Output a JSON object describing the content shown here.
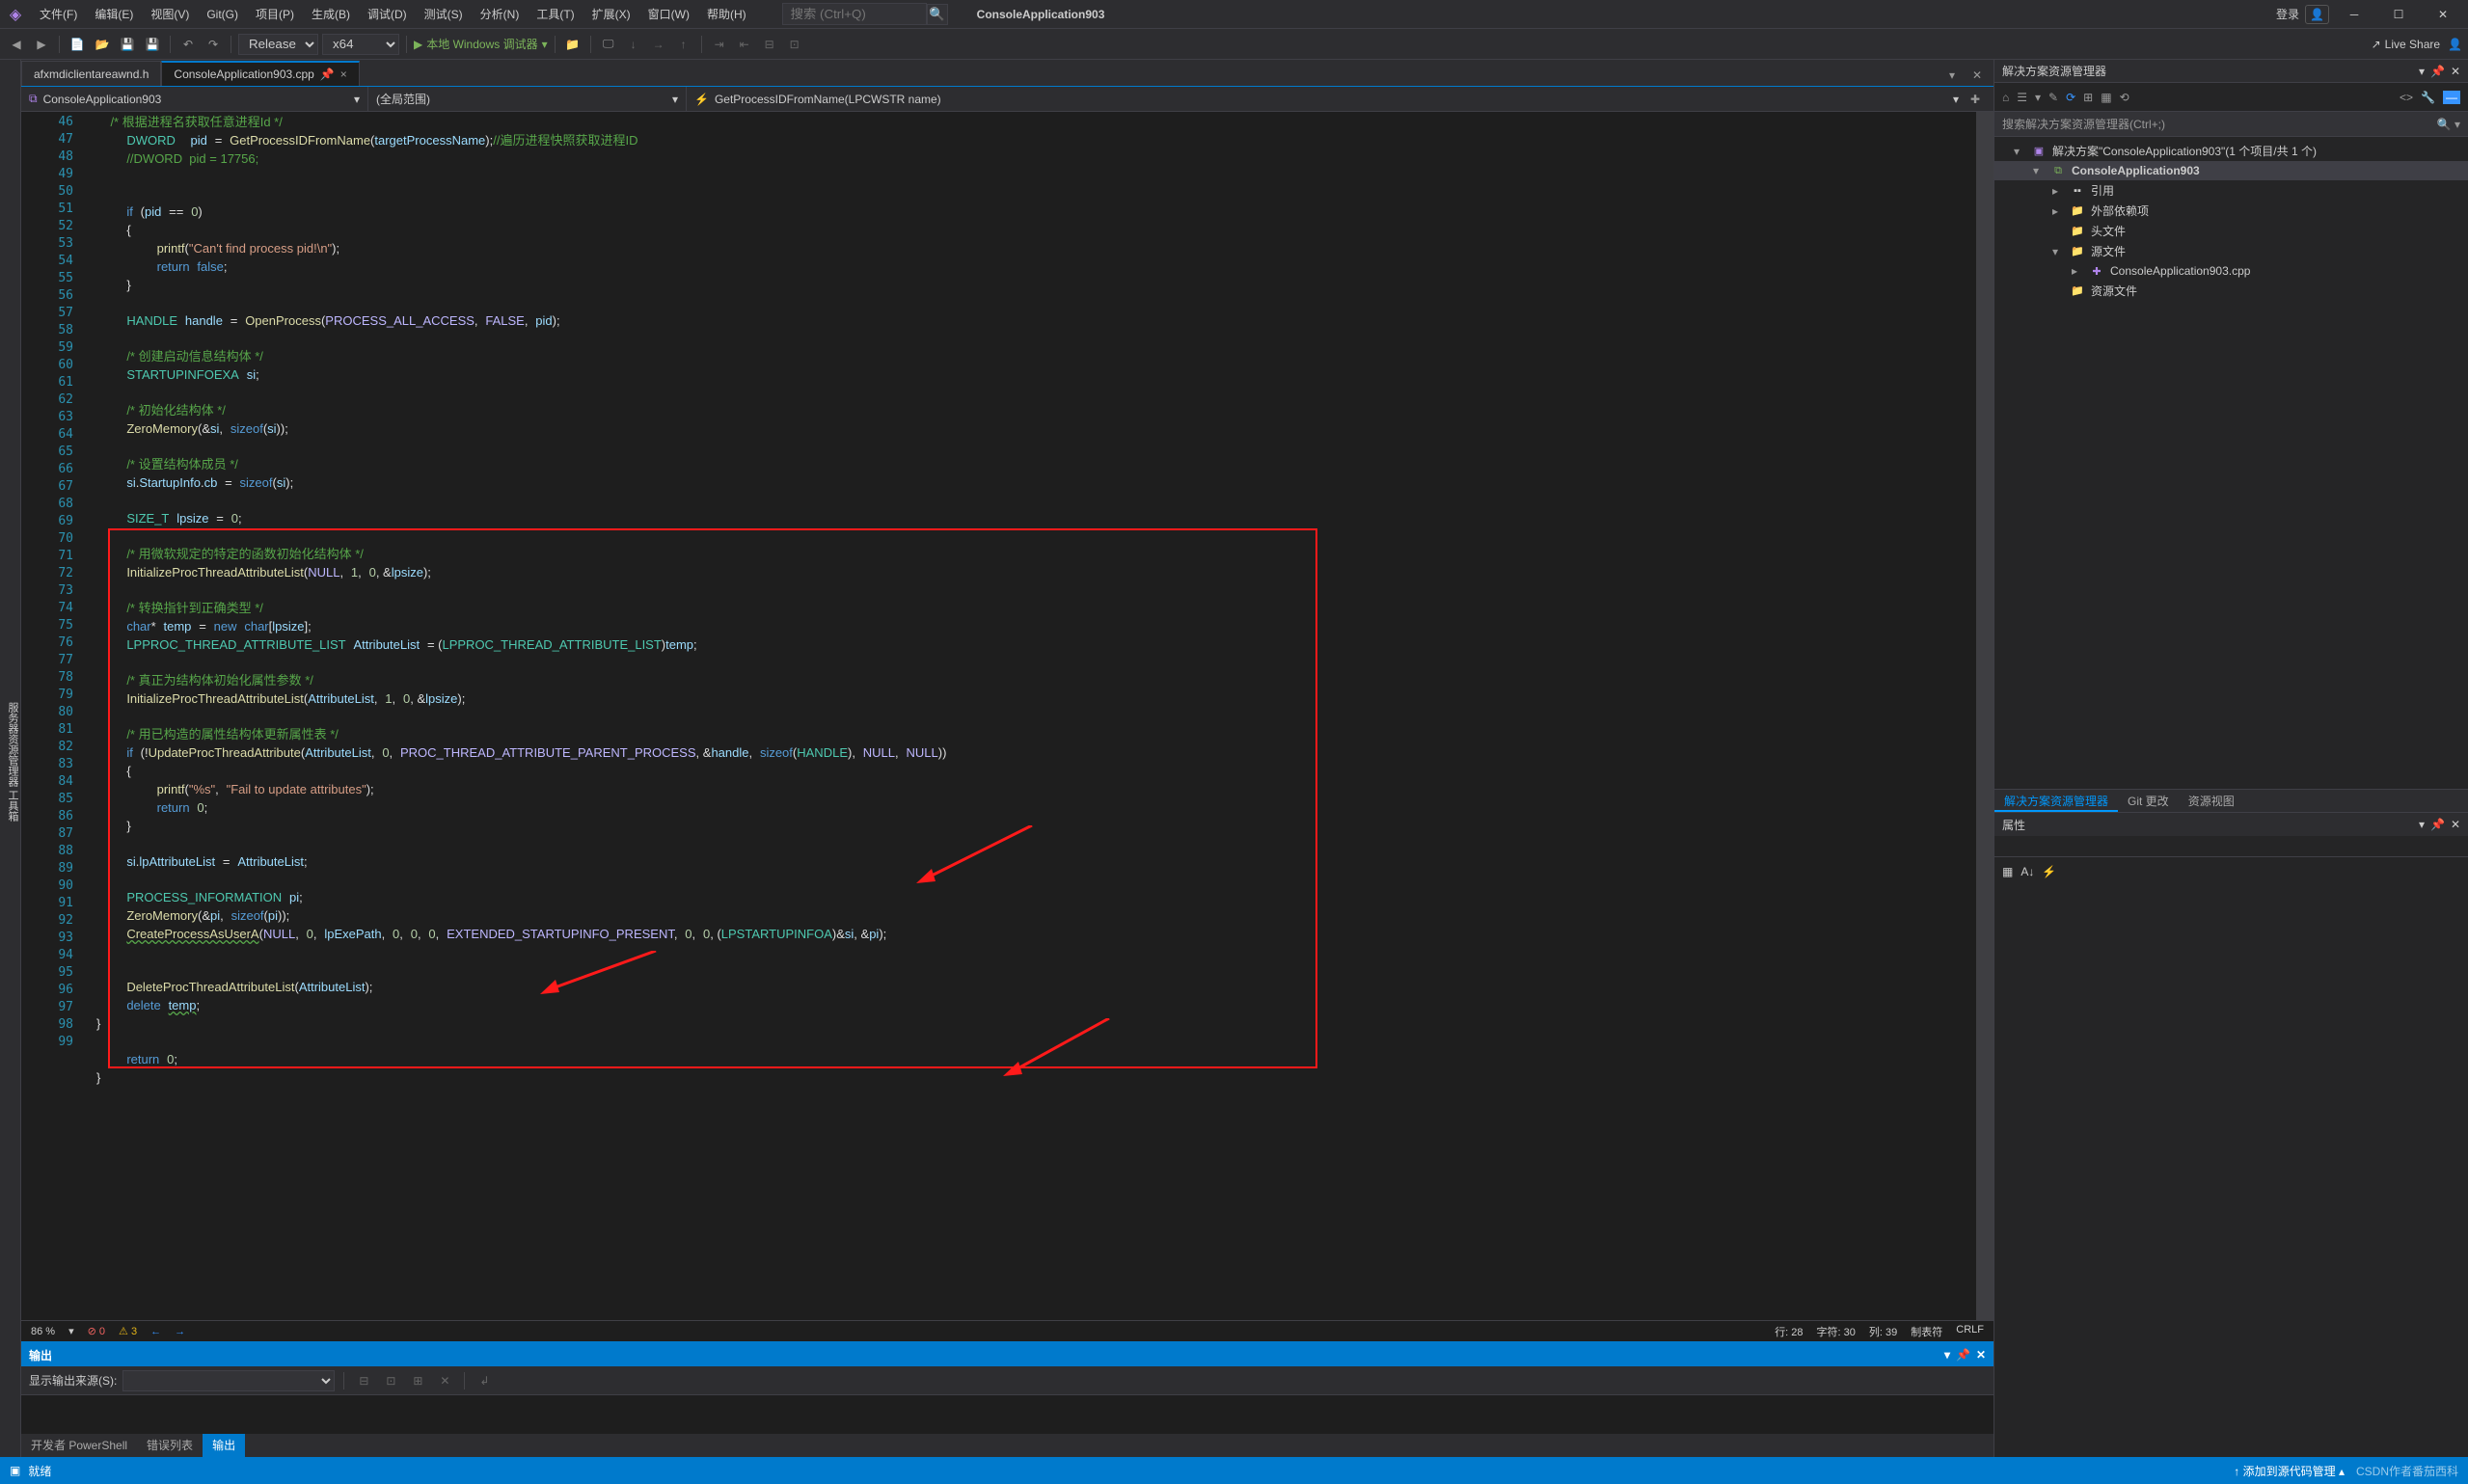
{
  "title": "ConsoleApplication903",
  "login_label": "登录",
  "menubar": [
    "文件(F)",
    "编辑(E)",
    "视图(V)",
    "Git(G)",
    "项目(P)",
    "生成(B)",
    "调试(D)",
    "测试(S)",
    "分析(N)",
    "工具(T)",
    "扩展(X)",
    "窗口(W)",
    "帮助(H)"
  ],
  "search_placeholder": "搜索 (Ctrl+Q)",
  "toolbar": {
    "config": "Release",
    "platform": "x64",
    "debugger": "本地 Windows 调试器",
    "live_share": "Live Share"
  },
  "left_gutter": "服务器资源管理器  工具箱",
  "tabs": {
    "t1": "afxmdiclientareawnd.h",
    "t2": "ConsoleApplication903.cpp"
  },
  "nav": {
    "scope": "ConsoleApplication903",
    "scope2": "(全局范围)",
    "member": "GetProcessIDFromName(LPCWSTR name)"
  },
  "code_lines": {
    "46": "    /* 根据进程名获取任意进程Id */",
    "47": "    DWORD  pid = GetProcessIDFromName(targetProcessName);//遍历进程快照获取进程ID",
    "48": "    //DWORD  pid = 17756;",
    "51": "    if (pid == 0)",
    "53": "        printf(\"Can't find process pid!\\n\");",
    "54": "        return false;",
    "57": "    HANDLE handle = OpenProcess(PROCESS_ALL_ACCESS, FALSE, pid);",
    "59": "    /* 创建启动信息结构体 */",
    "60": "    STARTUPINFOEXA si;",
    "62": "    /* 初始化结构体 */",
    "63": "    ZeroMemory(&si, sizeof(si));",
    "65": "    /* 设置结构体成员 */",
    "66": "    si.StartupInfo.cb = sizeof(si);",
    "68": "    SIZE_T lpsize = 0;",
    "70": "    /* 用微软规定的特定的函数初始化结构体 */",
    "71": "    InitializeProcThreadAttributeList(NULL, 1, 0, &lpsize);",
    "73": "    /* 转换指针到正确类型 */",
    "74": "    char* temp = new char[lpsize];",
    "75": "    LPPROC_THREAD_ATTRIBUTE_LIST AttributeList = (LPPROC_THREAD_ATTRIBUTE_LIST)temp;",
    "77": "    /* 真正为结构体初始化属性参数 */",
    "78": "    InitializeProcThreadAttributeList(AttributeList, 1, 0, &lpsize);",
    "80": "    /* 用已构造的属性结构体更新属性表 */",
    "81": "    if (!UpdateProcThreadAttribute(AttributeList, 0, PROC_THREAD_ATTRIBUTE_PARENT_PROCESS, &handle, sizeof(HANDLE), NULL, NULL))",
    "83": "        printf(\"%s\", \"Fail to update attributes\");",
    "84": "        return 0;",
    "87": "    si.lpAttributeList = AttributeList;",
    "89": "    PROCESS_INFORMATION pi;",
    "90": "    ZeroMemory(&pi, sizeof(pi));",
    "91": "    CreateProcessAsUserA(NULL, 0, lpExePath, 0, 0, 0, EXTENDED_STARTUPINFO_PRESENT, 0, 0, (LPSTARTUPINFOA)&si, &pi);",
    "94": "    DeleteProcThreadAttributeList(AttributeList);",
    "95": "    delete temp;",
    "98": "    return 0;"
  },
  "status": {
    "zoom": "86 %",
    "errors": "0",
    "warnings": "3",
    "line": "行: 28",
    "col": "字符: 30",
    "colnum": "列: 39",
    "tabs": "制表符",
    "crlf": "CRLF"
  },
  "output": {
    "title": "输出",
    "source_label": "显示输出来源(S):"
  },
  "bottom_tabs": [
    "开发者 PowerShell",
    "错误列表",
    "输出"
  ],
  "solution": {
    "panel_title": "解决方案资源管理器",
    "search_placeholder": "搜索解决方案资源管理器(Ctrl+;)",
    "root": "解决方案\"ConsoleApplication903\"(1 个项目/共 1 个)",
    "project": "ConsoleApplication903",
    "refs": "引用",
    "ext": "外部依赖项",
    "hdr": "头文件",
    "src": "源文件",
    "srcfile": "ConsoleApplication903.cpp",
    "res": "资源文件",
    "tabs": [
      "解决方案资源管理器",
      "Git 更改",
      "资源视图"
    ]
  },
  "props": {
    "title": "属性"
  },
  "appstatus": {
    "ready": "就绪",
    "source_ctrl": "添加到源代码管理",
    "watermark": "CSDN作者番茄西科"
  }
}
